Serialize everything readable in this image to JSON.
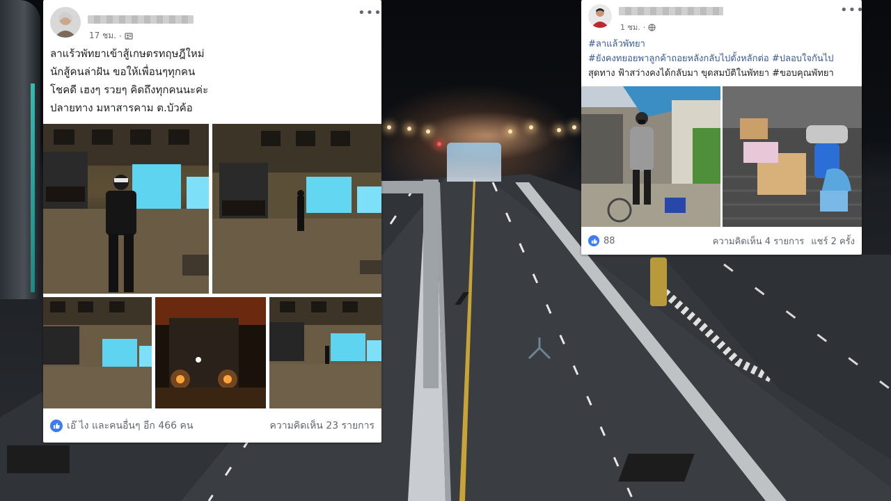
{
  "left_post": {
    "time": "17 ชม.",
    "privacy_icon": "friends-icon",
    "lines": [
      "ลาแร้วพัทยาเข้าสู้เกษตรทฤษฎีใหม่",
      "นักสู้คนล่าฝัน ขอให้เพื่อนๆทุกคน",
      "โชคดี เฮงๆ รวยๆ คิดถึงทุกคนนะค่ะ",
      "ปลายทาง มหาสารคาม ต.บัวค้อ"
    ],
    "reactions_text": "เอ๊ ไง และคนอื่นๆ อีก 466 คน",
    "comments_text": "ความคิดเห็น 23 รายการ"
  },
  "right_post": {
    "time": "1 ชม.",
    "privacy_icon": "globe-icon",
    "lines": [
      "#ลาแล้วพัทยา",
      "#ยังคงทยอยพาลูกค้าถอยหลังกลับไปตั้งหลักต่อ #ปลอบใจกันไป",
      "สุดทาง ฟ้าสว่างคงได้กลับมา ขุดสมบัติในพัทยา #ขอบคุณพัทยา"
    ],
    "reaction_count": "88",
    "comments_text": "ความคิดเห็น 4 รายการ",
    "shares_text": "แชร์ 2 ครั้ง"
  },
  "colors": {
    "fb_blue": "#385898",
    "like_blue": "#3b7bf6",
    "text_dark": "#1c1e21",
    "meta_gray": "#65676b"
  }
}
